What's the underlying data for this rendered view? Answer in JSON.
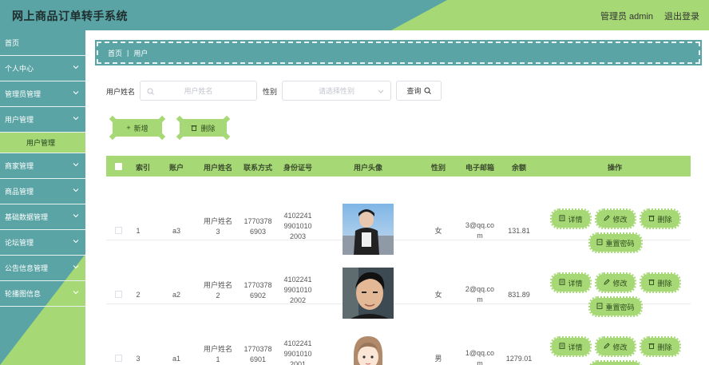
{
  "header": {
    "title": "网上商品订单转手系统",
    "user_label": "管理员 admin",
    "logout_label": "退出登录"
  },
  "sidebar": {
    "items": [
      {
        "label": "首页",
        "chevron": false
      },
      {
        "label": "个人中心",
        "chevron": true
      },
      {
        "label": "管理员管理",
        "chevron": true
      },
      {
        "label": "用户管理",
        "chevron": true
      },
      {
        "label": "用户管理",
        "sub": true
      },
      {
        "label": "商家管理",
        "chevron": true
      },
      {
        "label": "商品管理",
        "chevron": true
      },
      {
        "label": "基础数据管理",
        "chevron": true
      },
      {
        "label": "论坛管理",
        "chevron": true
      },
      {
        "label": "公告信息管理",
        "chevron": true
      },
      {
        "label": "轮播图信息",
        "chevron": true
      }
    ]
  },
  "breadcrumb": {
    "home": "首页",
    "current": "用户"
  },
  "search": {
    "name_label": "用户姓名",
    "name_placeholder": "用户姓名",
    "gender_label": "性别",
    "gender_placeholder": "请选择性别",
    "query_label": "查询"
  },
  "actions": {
    "add_label": "新增",
    "delete_label": "删除"
  },
  "table": {
    "headers": [
      "索引",
      "账户",
      "用户姓名",
      "联系方式",
      "身份证号",
      "用户头像",
      "性别",
      "电子邮箱",
      "余额",
      "操作"
    ],
    "rows": [
      {
        "index": "1",
        "account": "a3",
        "name": [
          "用户姓名",
          "3"
        ],
        "phone": [
          "1770378",
          "6903"
        ],
        "id": [
          "4102241",
          "9901010",
          "2003"
        ],
        "gender": "女",
        "email": [
          "3@qq.co",
          "m"
        ],
        "balance": "131.81"
      },
      {
        "index": "2",
        "account": "a2",
        "name": [
          "用户姓名",
          "2"
        ],
        "phone": [
          "1770378",
          "6902"
        ],
        "id": [
          "4102241",
          "9901010",
          "2002"
        ],
        "gender": "女",
        "email": [
          "2@qq.co",
          "m"
        ],
        "balance": "831.89"
      },
      {
        "index": "3",
        "account": "a1",
        "name": [
          "用户姓名",
          "1"
        ],
        "phone": [
          "1770378",
          "6901"
        ],
        "id": [
          "4102241",
          "9901010",
          "2001"
        ],
        "gender": "男",
        "email": [
          "1@qq.co",
          "m"
        ],
        "balance": "1279.01"
      }
    ],
    "ops": {
      "detail": "详情",
      "edit": "修改",
      "delete": "删除",
      "reset": "重置密码"
    }
  },
  "colors": {
    "teal": "#5aa4a6",
    "green": "#a6d975"
  }
}
